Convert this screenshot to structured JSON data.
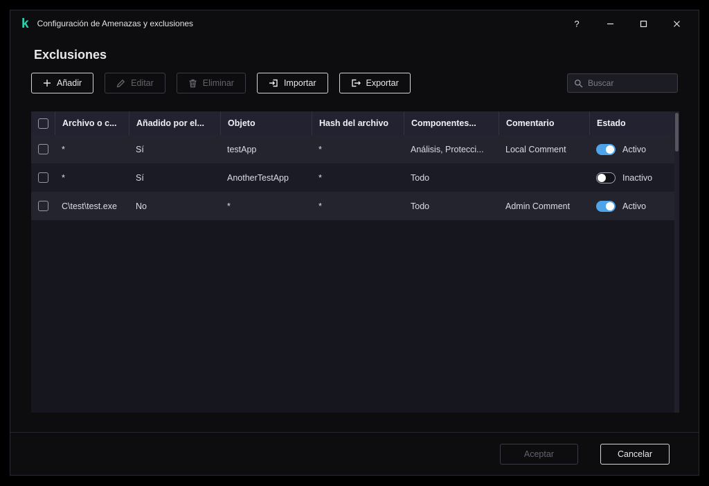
{
  "window": {
    "logo_glyph": "k",
    "title": "Configuración de Amenazas y exclusiones",
    "controls": {
      "help": "?"
    }
  },
  "page": {
    "title": "Exclusiones"
  },
  "toolbar": {
    "add_label": "Añadir",
    "edit_label": "Editar",
    "delete_label": "Eliminar",
    "import_label": "Importar",
    "export_label": "Exportar",
    "search_placeholder": "Buscar"
  },
  "table": {
    "headers": [
      "Archivo o c...",
      "Añadido por el...",
      "Objeto",
      "Hash del archivo",
      "Componentes...",
      "Comentario",
      "Estado"
    ],
    "rows": [
      {
        "file": "*",
        "added_by": "Sí",
        "object": "testApp",
        "hash": "*",
        "components": "Análisis, Protecci...",
        "comment": "Local Comment",
        "enabled": true,
        "status": "Activo"
      },
      {
        "file": "*",
        "added_by": "Sí",
        "object": "AnotherTestApp",
        "hash": "*",
        "components": "Todo",
        "comment": "",
        "enabled": false,
        "status": "Inactivo"
      },
      {
        "file": "C\\test\\test.exe",
        "added_by": "No",
        "object": "*",
        "hash": "*",
        "components": "Todo",
        "comment": "Admin Comment",
        "enabled": true,
        "status": "Activo"
      }
    ]
  },
  "footer": {
    "accept_label": "Aceptar",
    "cancel_label": "Cancelar"
  },
  "colors": {
    "accent-green": "#2bd4ae",
    "toggle-blue": "#4fa3e8",
    "window-bg": "#0d0d10",
    "panel-bg": "#16161e",
    "header-bg": "#222230",
    "row-odd": "#24242e",
    "row-even": "#1b1b25",
    "text": "#e8e8ec"
  }
}
